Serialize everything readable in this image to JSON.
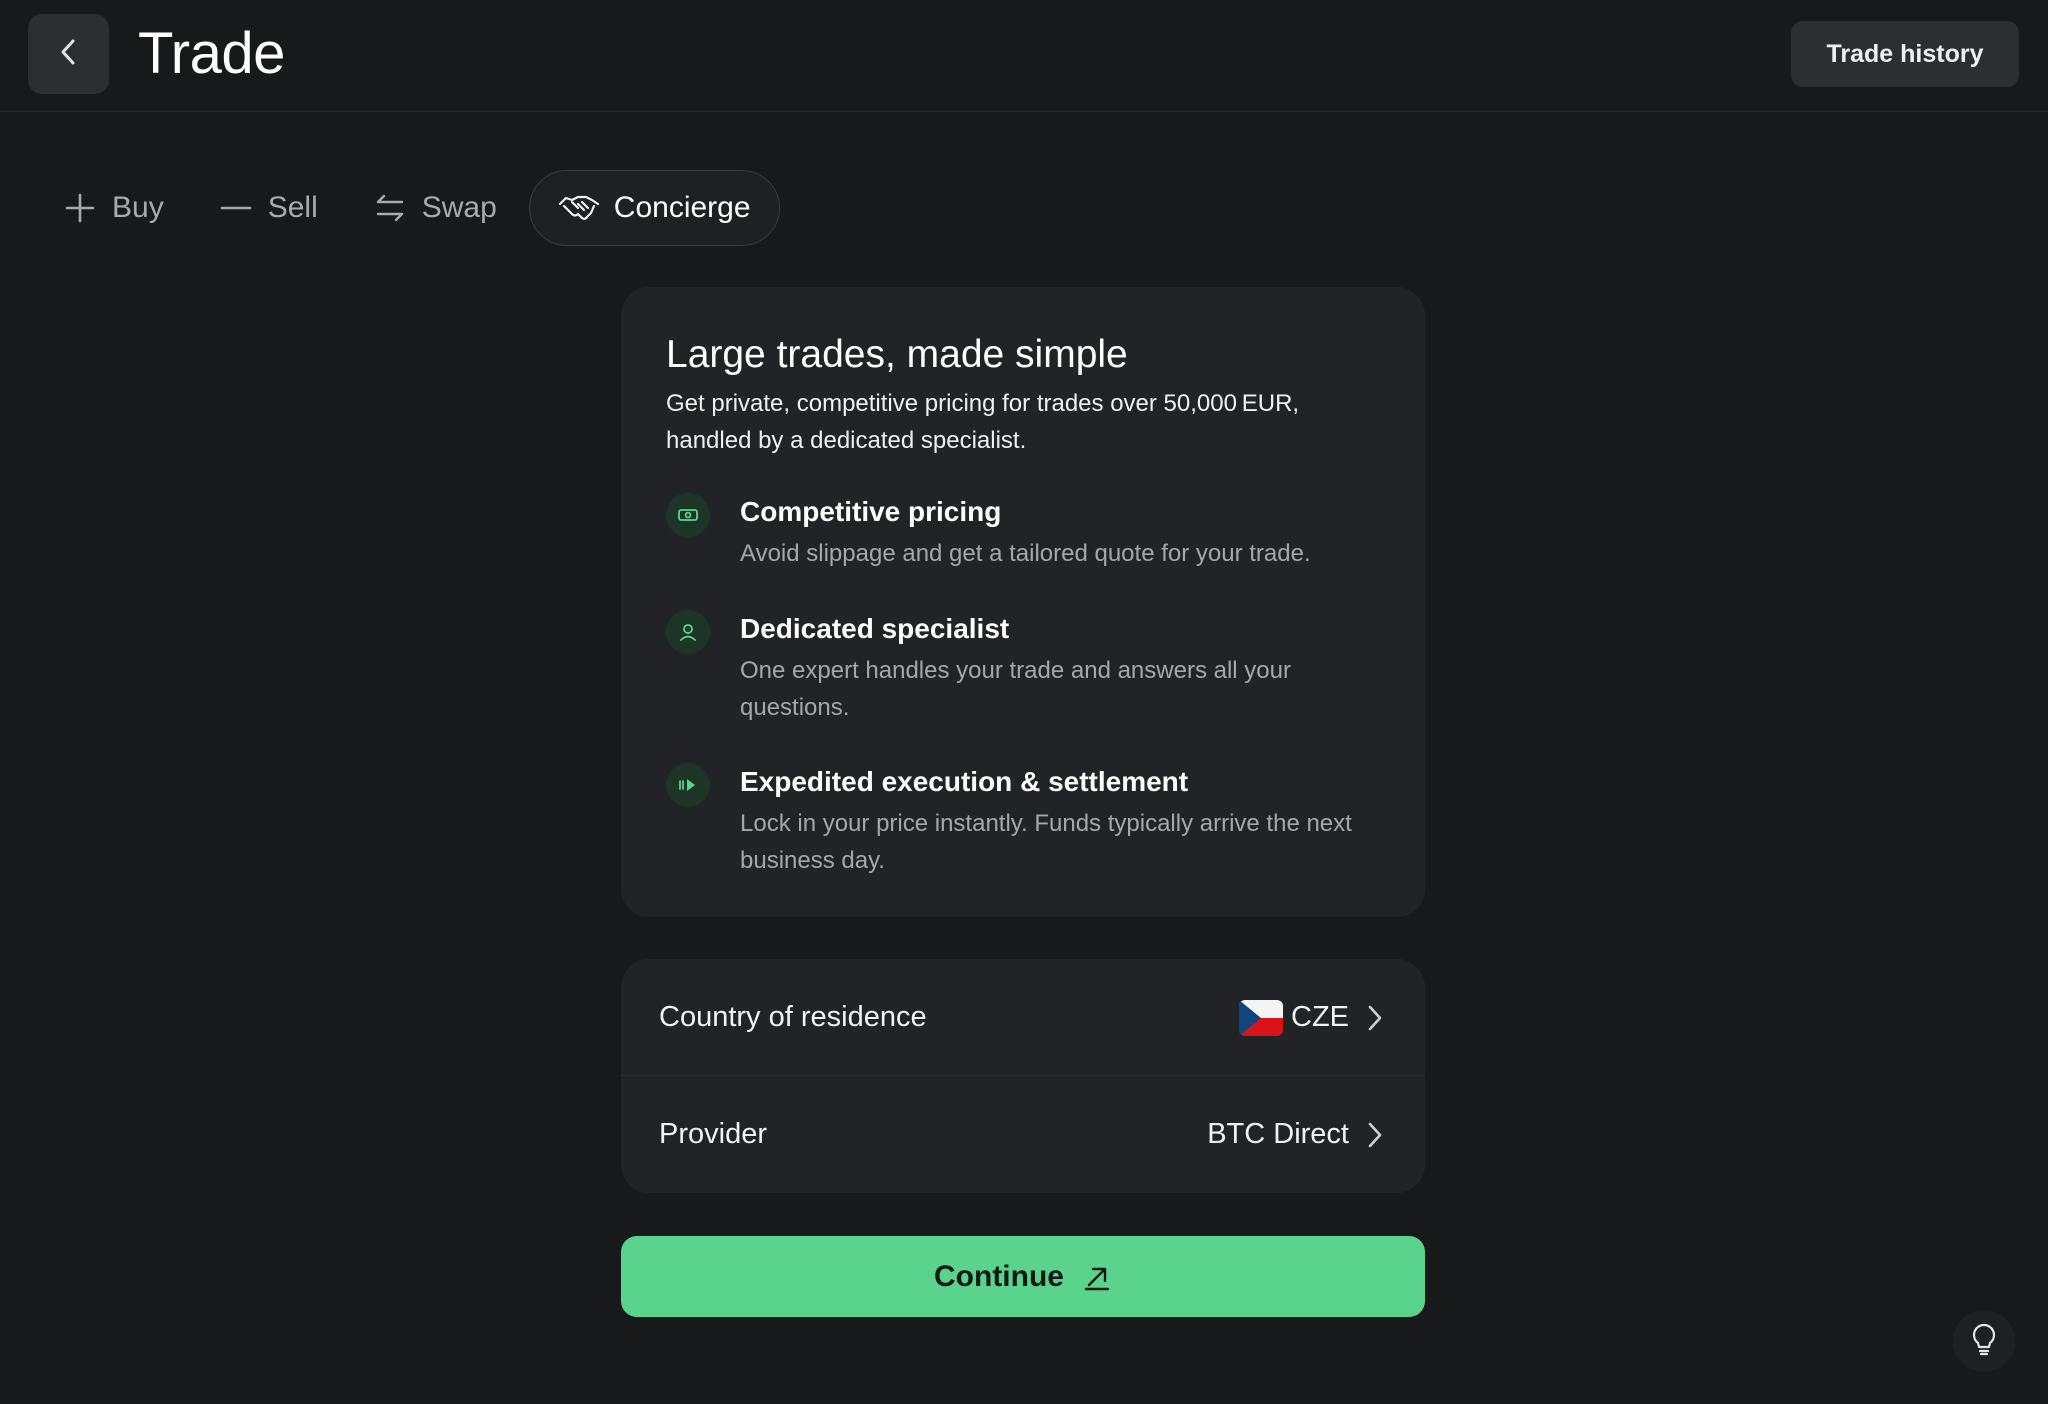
{
  "header": {
    "title": "Trade",
    "history_label": "Trade history",
    "back_icon": "chevron-left-icon"
  },
  "tabs": [
    {
      "label": "Buy",
      "icon": "plus-icon",
      "active": false
    },
    {
      "label": "Sell",
      "icon": "minus-icon",
      "active": false
    },
    {
      "label": "Swap",
      "icon": "swap-arrows-icon",
      "active": false
    },
    {
      "label": "Concierge",
      "icon": "handshake-icon",
      "active": true
    }
  ],
  "concierge": {
    "title": "Large trades, made simple",
    "subtitle": "Get private, competitive pricing for trades over 50,000 EUR, handled by a dedicated specialist.",
    "features": [
      {
        "icon": "banknote-icon",
        "title": "Competitive pricing",
        "description": "Avoid slippage and get a tailored quote for your trade."
      },
      {
        "icon": "person-icon",
        "title": "Dedicated specialist",
        "description": "One expert handles your trade and answers all your questions."
      },
      {
        "icon": "fast-forward-icon",
        "title": "Expedited execution & settlement",
        "description": "Lock in your price instantly. Funds typically arrive the next business day."
      }
    ]
  },
  "settings": {
    "country_label": "Country of residence",
    "country_value": "CZE",
    "country_flag_icon": "czech-flag-icon",
    "provider_label": "Provider",
    "provider_value": "BTC Direct"
  },
  "continue_label": "Continue",
  "colors": {
    "background": "#18191b",
    "card": "#222326",
    "accent": "#5ad48d",
    "icon_bg": "#1d3526"
  }
}
